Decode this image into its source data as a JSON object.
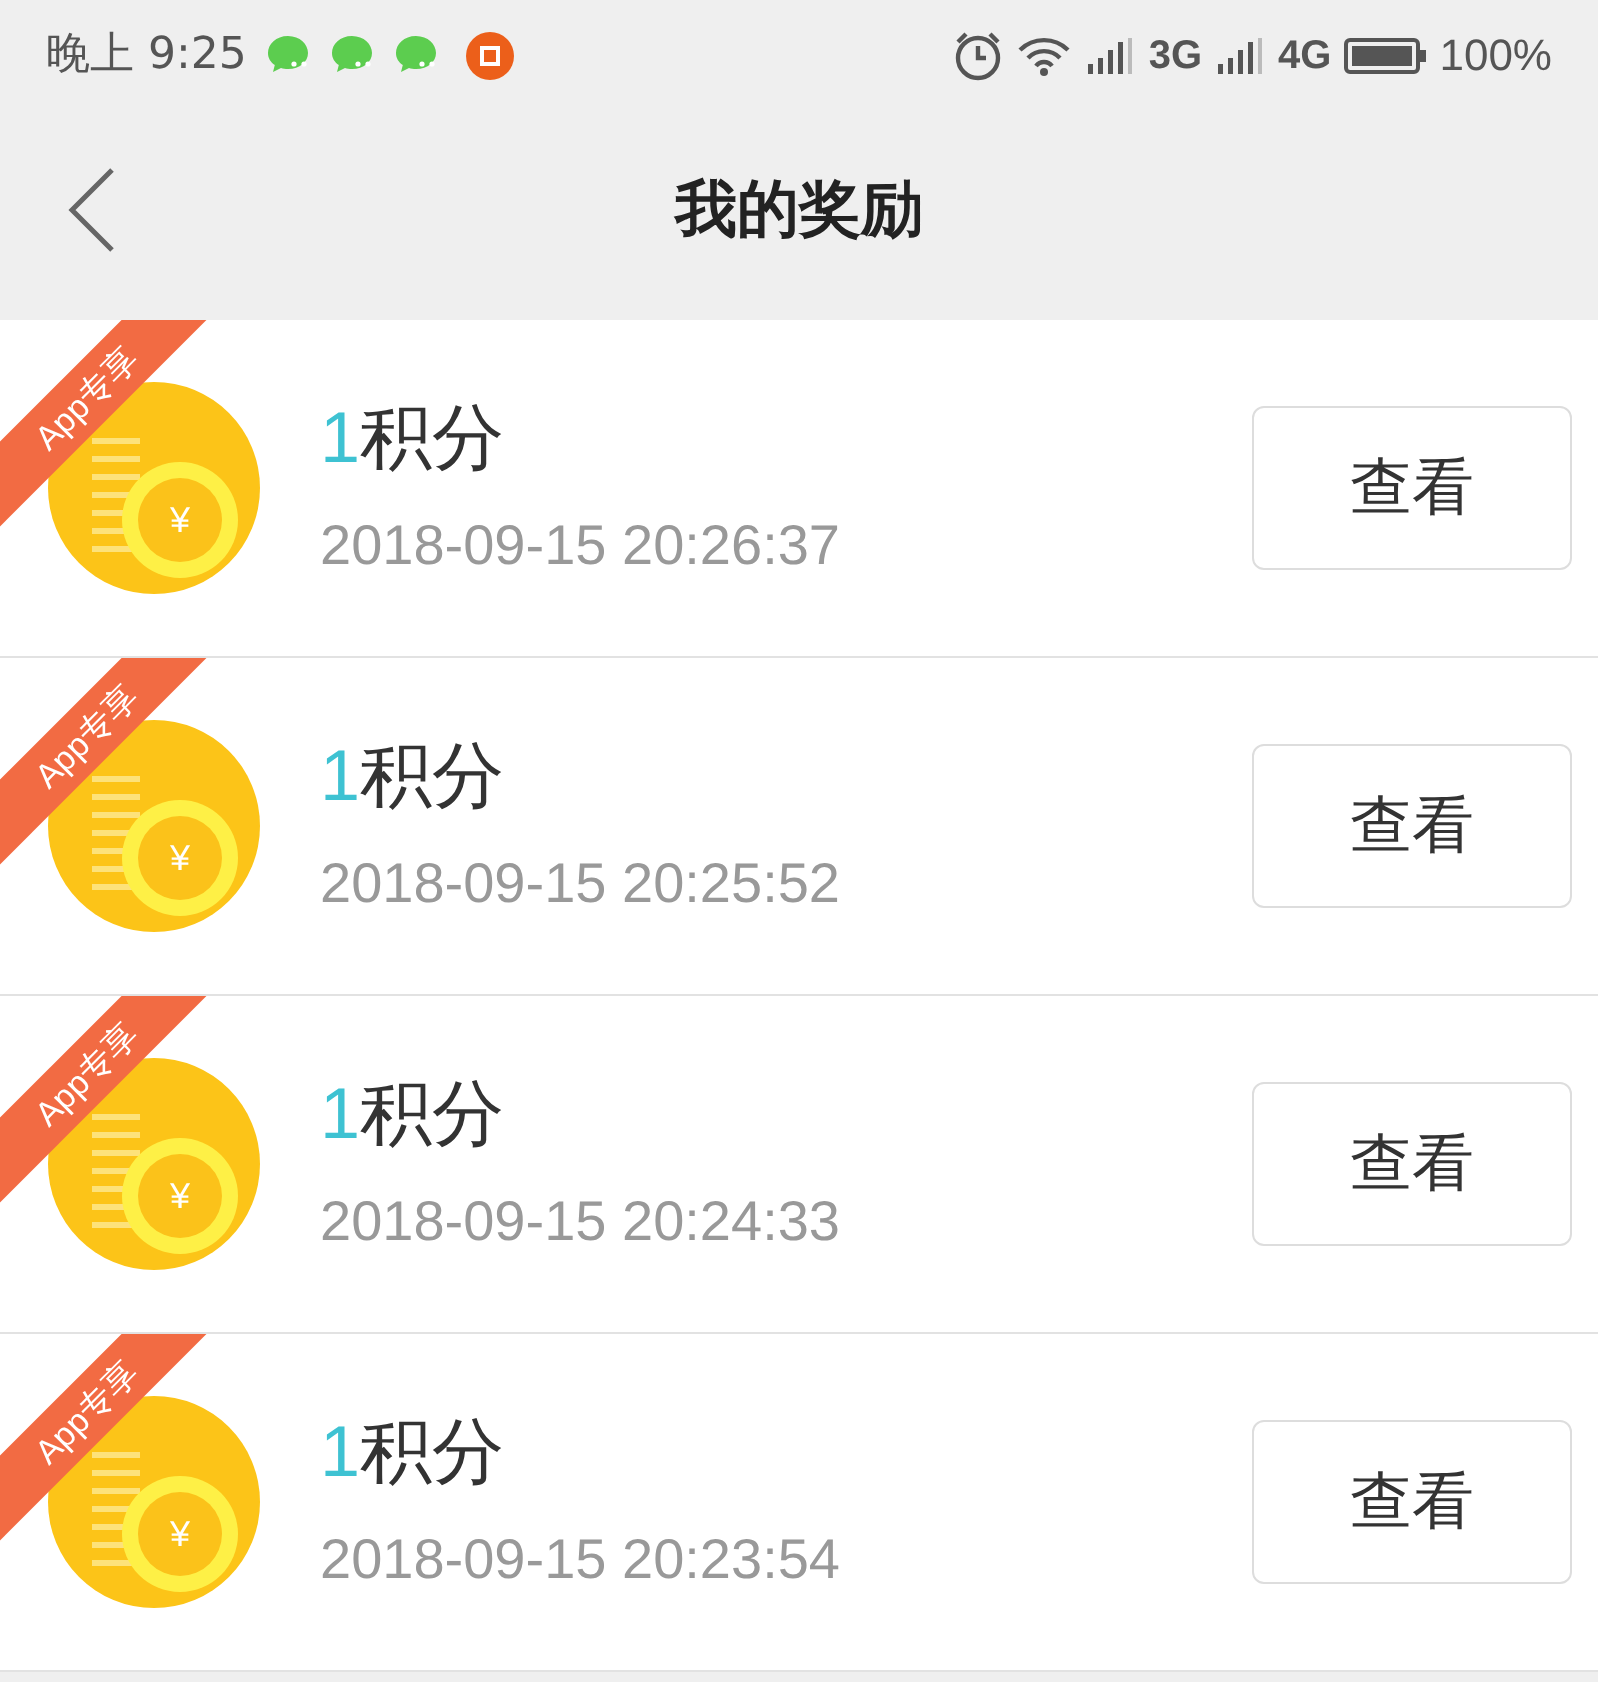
{
  "status_bar": {
    "time": "晚上 9:25",
    "network_1": "3G",
    "network_2": "4G",
    "battery": "100%"
  },
  "header": {
    "title": "我的奖励"
  },
  "rewards": [
    {
      "badge": "App专享",
      "coin_symbol": "¥",
      "amount": "1",
      "unit": "积分",
      "time": "2018-09-15 20:26:37",
      "button": "查看"
    },
    {
      "badge": "App专享",
      "coin_symbol": "¥",
      "amount": "1",
      "unit": "积分",
      "time": "2018-09-15 20:25:52",
      "button": "查看"
    },
    {
      "badge": "App专享",
      "coin_symbol": "¥",
      "amount": "1",
      "unit": "积分",
      "time": "2018-09-15 20:24:33",
      "button": "查看"
    },
    {
      "badge": "App专享",
      "coin_symbol": "¥",
      "amount": "1",
      "unit": "积分",
      "time": "2018-09-15 20:23:54",
      "button": "查看"
    }
  ]
}
